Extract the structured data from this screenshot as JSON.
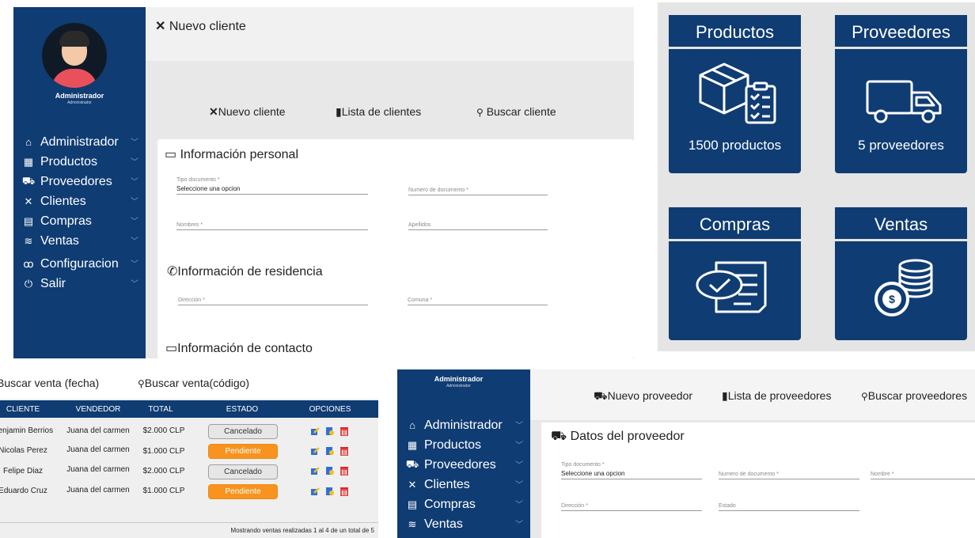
{
  "panel_client": {
    "sidebar": {
      "user_name": "Administrador",
      "user_role": "Administrador",
      "items": [
        {
          "label": "Administrador",
          "icon": "home-icon"
        },
        {
          "label": "Productos",
          "icon": "box-icon"
        },
        {
          "label": "Proveedores",
          "icon": "truck-icon"
        },
        {
          "label": "Clientes",
          "icon": "handshake-icon"
        },
        {
          "label": "Compras",
          "icon": "cart-icon"
        },
        {
          "label": "Ventas",
          "icon": "money-icon"
        },
        {
          "label": "Configuracion",
          "icon": "settings-icon"
        },
        {
          "label": "Salir",
          "icon": "power-icon"
        }
      ]
    },
    "header_title": "Nuevo cliente",
    "tabs": {
      "new": "Nuevo cliente",
      "list": "Lista de clientes",
      "search": "Buscar cliente"
    },
    "sections": {
      "personal": "Información personal",
      "residence": "Información de residencia",
      "contact": "Información de contacto"
    },
    "fields": {
      "doc_type_label": "Tipo documento *",
      "doc_type_value": "Seleccione una opcion",
      "doc_number_label": "Numero de documento *",
      "names_label": "Nombres *",
      "lastnames_label": "Apellidos",
      "address_label": "Dirección *",
      "commune_label": "Comuna *"
    }
  },
  "dashboard": {
    "tiles": [
      {
        "title": "Productos",
        "subtitle": "1500 productos",
        "icon": "box-clipboard-icon"
      },
      {
        "title": "Proveedores",
        "subtitle": "5 proveedores",
        "icon": "truck-icon"
      },
      {
        "title": "Compras",
        "subtitle": "",
        "icon": "invoice-check-icon"
      },
      {
        "title": "Ventas",
        "subtitle": "",
        "icon": "coins-icon"
      }
    ],
    "accent": "#0f3c73"
  },
  "sales": {
    "search_date": "Buscar venta (fecha)",
    "search_code": "Buscar venta(código)",
    "columns": [
      "CLIENTE",
      "VENDEDOR",
      "TOTAL",
      "ESTADO",
      "OPCIONES"
    ],
    "rows": [
      {
        "cliente": "Benjamin Berrios",
        "vendedor": "Juana del carmen",
        "total": "$2.000 CLP",
        "estado": "Cancelado"
      },
      {
        "cliente": "Nicolas Perez",
        "vendedor": "Juana del carmen",
        "total": "$1.000 CLP",
        "estado": "Pendiente"
      },
      {
        "cliente": "Felipe Diaz",
        "vendedor": "Juana del carmen",
        "total": "$2.000 CLP",
        "estado": "Cancelado"
      },
      {
        "cliente": "Eduardo Cruz",
        "vendedor": "Juana del carmen",
        "total": "$1.000 CLP",
        "estado": "Pendiente"
      }
    ],
    "footer": "Mostrando ventas realizadas 1 al 4 de un total de 5",
    "status_colors": {
      "Cancelado": "#e6e6e6",
      "Pendiente": "#f7931e"
    }
  },
  "supplier": {
    "sidebar": {
      "user_name": "Administrador",
      "user_role": "Administrador",
      "items": [
        {
          "label": "Administrador",
          "icon": "home-icon"
        },
        {
          "label": "Productos",
          "icon": "box-icon"
        },
        {
          "label": "Proveedores",
          "icon": "truck-icon"
        },
        {
          "label": "Clientes",
          "icon": "handshake-icon"
        },
        {
          "label": "Compras",
          "icon": "cart-icon"
        },
        {
          "label": "Ventas",
          "icon": "money-icon"
        }
      ]
    },
    "tabs": {
      "new": "Nuevo proveedor",
      "list": "Lista de proveedores",
      "search": "Buscar proveedores"
    },
    "section": "Datos del proveedor",
    "fields": {
      "doc_type_label": "Tipo documento *",
      "doc_type_value": "Seleccione una opcion",
      "doc_number_label": "Numero de documento *",
      "name_label": "Nombre *",
      "address_label": "Dirección *",
      "state_label": "Estado"
    }
  }
}
